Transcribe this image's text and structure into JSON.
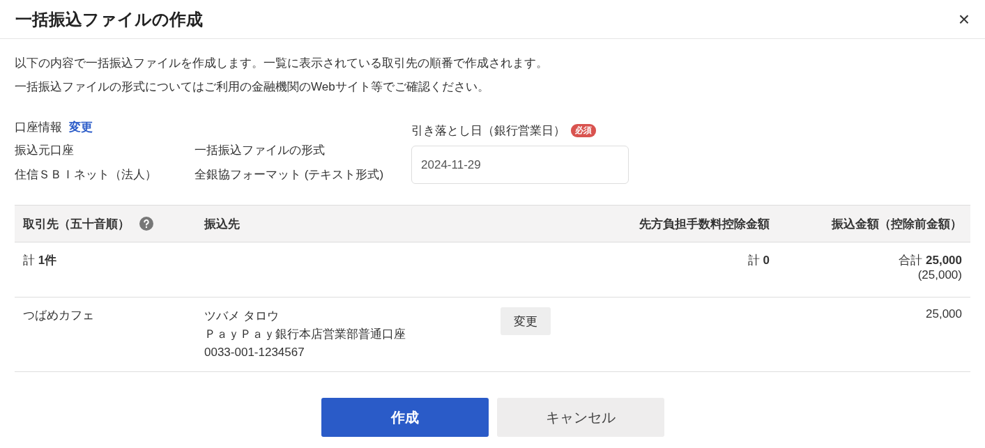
{
  "dialog": {
    "title": "一括振込ファイルの作成",
    "close": "×"
  },
  "description": [
    "以下の内容で一括振込ファイルを作成します。一覧に表示されている取引先の順番で作成されます。",
    "一括振込ファイルの形式についてはご利用の金融機関のWebサイト等でご確認ください。"
  ],
  "account_info": {
    "label": "口座情報",
    "change_link": "変更",
    "source_label": "振込元口座",
    "source_value": "住信ＳＢＩネット（法人）",
    "format_label": "一括振込ファイルの形式",
    "format_value": "全銀協フォーマット (テキスト形式)"
  },
  "debit_date": {
    "label": "引き落とし日（銀行営業日）",
    "required_badge": "必須",
    "value": "2024-11-29"
  },
  "table": {
    "columns": [
      "取引先（五十音順）",
      "振込先",
      "先方負担手数料控除金額",
      "振込金額（控除前金額）"
    ],
    "summary": {
      "count": "計 **1件**",
      "fee": "計 **0**",
      "total": "合計 **25,000**",
      "total_sub": "(25,000)"
    },
    "rows": [
      {
        "partner": "つばめカフェ",
        "payee_name": "ツバメ タロウ",
        "payee_bank": "ＰａｙＰａｙ銀行本店営業部普通口座",
        "payee_account": "0033-001-1234567",
        "change_button": "変更",
        "amount": "25,000"
      }
    ]
  },
  "buttons": [
    {
      "label": "作成",
      "kind": "primary"
    },
    {
      "label": "キャンセル",
      "kind": "secondary"
    }
  ]
}
